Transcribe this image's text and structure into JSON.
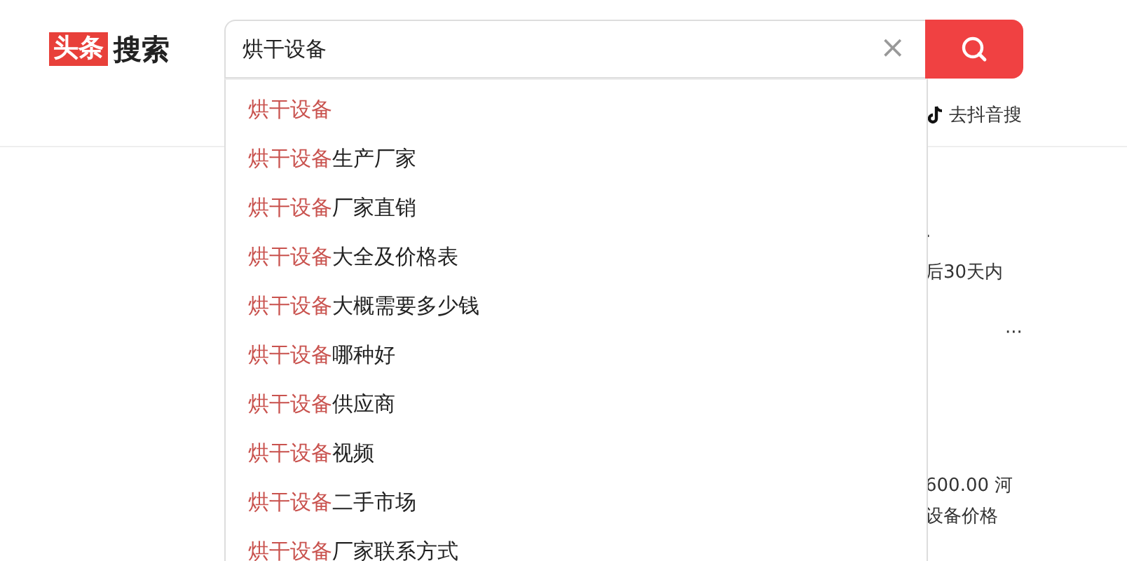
{
  "logo": {
    "badge": "头条",
    "text": "搜索"
  },
  "search": {
    "value": "烘干设备",
    "clear": "×"
  },
  "douyin_link": "去抖音搜",
  "suggestions": [
    {
      "match": "烘干设备"
    },
    {
      "match": "烘干设备",
      "rest": "生产厂家"
    },
    {
      "match": "烘干设备",
      "rest": "厂家直销"
    },
    {
      "match": "烘干设备",
      "rest": "大全及价格表"
    },
    {
      "match": "烘干设备",
      "rest": "大概需要多少钱"
    },
    {
      "match": "烘干设备",
      "rest": "哪种好"
    },
    {
      "match": "烘干设备",
      "rest": "供应商"
    },
    {
      "match": "烘干设备",
      "rest": "视频"
    },
    {
      "match": "烘干设备",
      "rest": "二手市场"
    },
    {
      "match": "烘干设备",
      "rest": "厂家联系方式"
    }
  ],
  "results_fragments": {
    "title_end": ".",
    "date_note": "后30天内",
    "more": "···",
    "price": "600.00 河",
    "price_note": "设备价格"
  }
}
